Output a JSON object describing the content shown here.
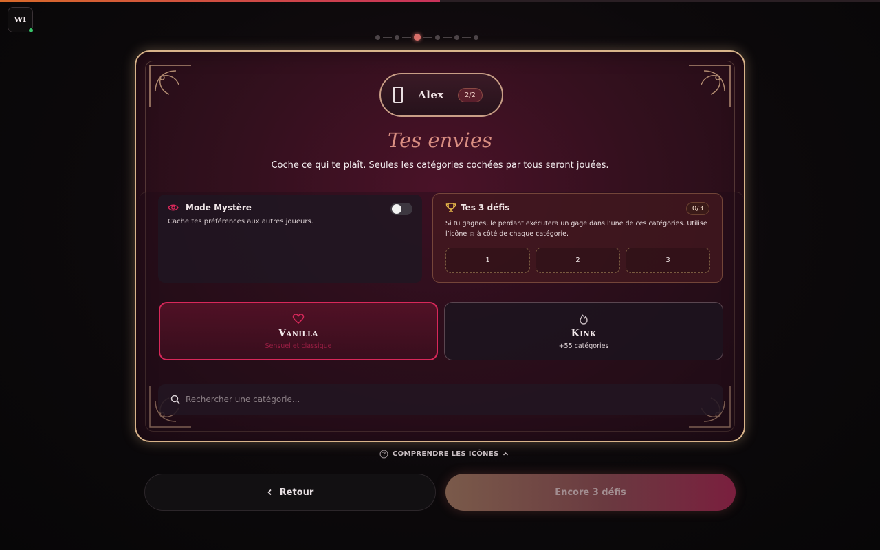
{
  "progress": {
    "percent": 50
  },
  "user_badge": {
    "initials": "WI",
    "online": true
  },
  "stepper": {
    "total": 6,
    "current": 3
  },
  "player": {
    "name": "Alex",
    "count": "2/2"
  },
  "heading": {
    "title": "Tes envies",
    "subtitle": "Coche ce qui te plaît. Seules les catégories cochées par tous seront jouées."
  },
  "mystery": {
    "title": "Mode Mystère",
    "description": "Cache tes préférences aux autres joueurs.",
    "enabled": false
  },
  "challenges": {
    "title": "Tes 3 défis",
    "count": "0/3",
    "description": "Si tu gagnes, le perdant exécutera un gage dans l’une de ces catégories. Utilise l’icône ☆ à côté de chaque catégorie.",
    "slots": [
      "1",
      "2",
      "3"
    ]
  },
  "types": [
    {
      "name": "Vanilla",
      "subtitle": "Sensuel et classique",
      "icon": "heart-icon",
      "selected": true
    },
    {
      "name": "Kink",
      "subtitle": "+55 catégories",
      "icon": "flame-icon",
      "selected": false
    }
  ],
  "search": {
    "placeholder": "Rechercher une catégorie...",
    "value": ""
  },
  "legend": {
    "label": "COMPRENDRE LES ICÔNES"
  },
  "actions": {
    "back_label": "Retour",
    "next_label": "Encore 3 défis"
  },
  "colors": {
    "accent": "#d8285a",
    "gold": "#d9b48a",
    "title": "#d98e82",
    "online": "#39c46a"
  }
}
